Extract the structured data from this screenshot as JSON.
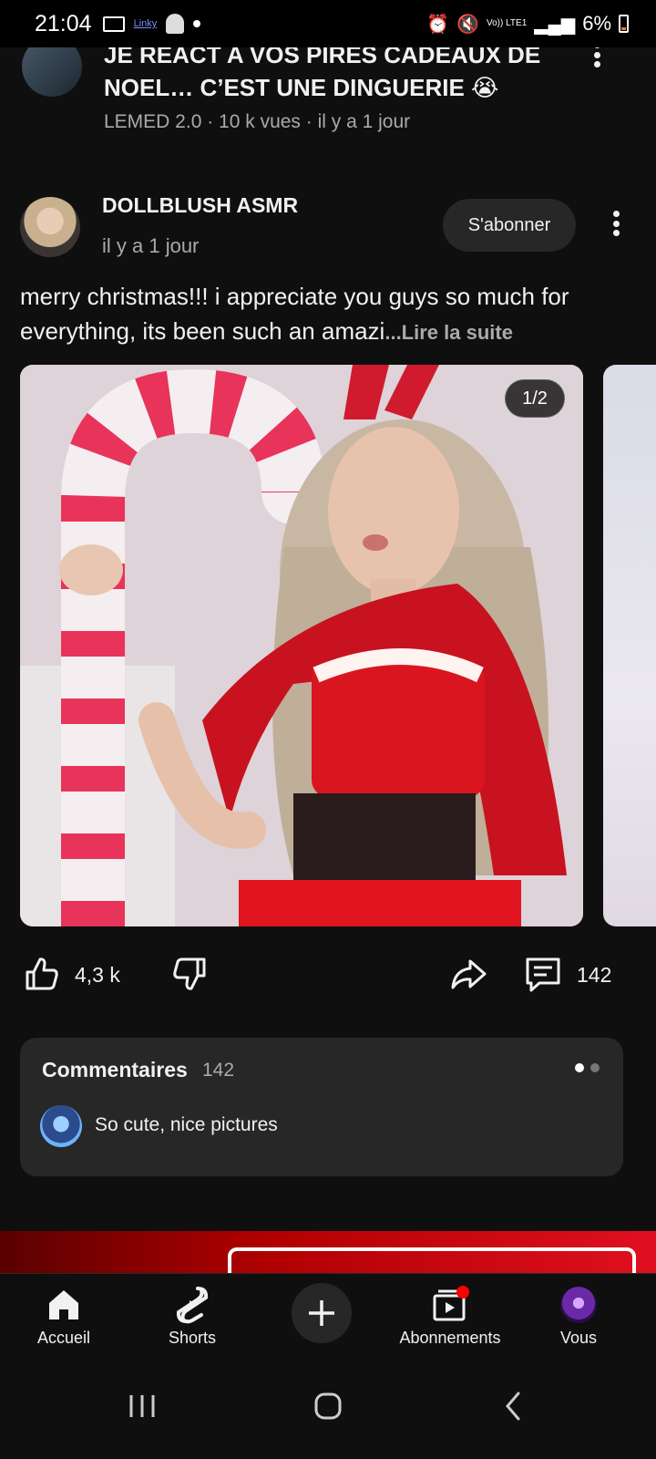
{
  "status_bar": {
    "time": "21:04",
    "linky": "Linky",
    "network": "Vo)) LTE1",
    "battery": "6%"
  },
  "previous_video": {
    "title": "JE REACT A VOS PIRES CADEAUX DE NOEL… C’EST UNE DINGUERIE 😭",
    "meta": "LEMED 2.0 · 10 k vues · il y a 1 jour"
  },
  "post": {
    "channel": "DOLLBLUSH ASMR",
    "time": "il y a 1 jour",
    "subscribe_label": "S'abonner",
    "text": "merry christmas!!! i appreciate you guys so much for everything, its been such an amazi",
    "read_more": "...Lire la suite",
    "image_counter": "1/2",
    "likes": "4,3 k",
    "comments_count": "142"
  },
  "comments": {
    "title": "Commentaires",
    "count": "142",
    "first_comment": "So cute, nice pictures"
  },
  "bottom_nav": {
    "items": [
      {
        "label": "Accueil",
        "icon": "home-icon"
      },
      {
        "label": "Shorts",
        "icon": "shorts-icon"
      },
      {
        "label": "",
        "icon": "create-icon"
      },
      {
        "label": "Abonnements",
        "icon": "subscriptions-icon"
      },
      {
        "label": "Vous",
        "icon": "avatar"
      }
    ]
  },
  "colors": {
    "background": "#0f0f0f",
    "surface": "#272727",
    "text": "#f1f1f1",
    "secondary_text": "#aaaaaa",
    "notification_dot": "#ff0000"
  }
}
